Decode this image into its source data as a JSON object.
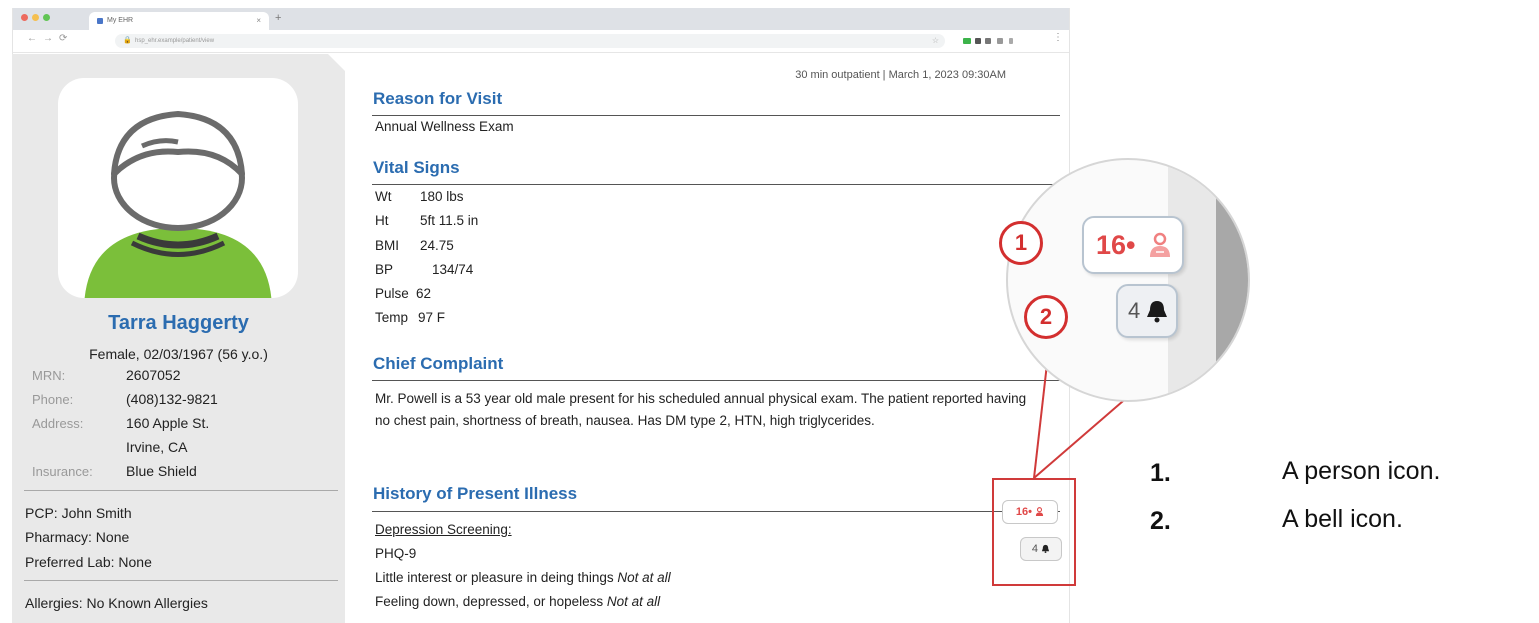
{
  "browser": {
    "tab_title": "My EHR",
    "tab_close": "×",
    "new_tab": "+",
    "nav_back": "←",
    "nav_forward": "→",
    "nav_reload": "⟳",
    "url": "hsp_ehr.example/patient/view",
    "menu": "⋮",
    "icons": [
      "back-arrow-icon",
      "forward-arrow-icon",
      "reload-icon",
      "lock-icon",
      "star-icon",
      "extension-icon",
      "menu-icon"
    ]
  },
  "patient": {
    "name": "Tarra Haggerty",
    "demographics": "Female, 02/03/1967 (56 y.o.)",
    "info": [
      {
        "label": "MRN:",
        "value": "2607052"
      },
      {
        "label": "Phone:",
        "value": "(408)132-9821"
      },
      {
        "label": "Address:",
        "value": "160 Apple St."
      },
      {
        "label": "",
        "value": "Irvine, CA"
      },
      {
        "label": "Insurance:",
        "value": "Blue Shield"
      }
    ],
    "care": [
      "PCP: John Smith",
      "Pharmacy: None",
      "Preferred Lab: None"
    ],
    "allergies": "Allergies: No Known Allergies",
    "avatar_colors": {
      "shirt": "#7bbf3a",
      "outline": "#6b6b6b"
    }
  },
  "note": {
    "visit_meta": "30 min outpatient | March 1, 2023 09:30AM",
    "reason_heading": "Reason for Visit",
    "reason": "Annual Wellness Exam",
    "vitals_heading": "Vital Signs",
    "vitals": [
      {
        "label": "Wt",
        "value": "180 lbs"
      },
      {
        "label": "Ht",
        "value": "5ft 11.5 in"
      },
      {
        "label": "BMI",
        "value": "24.75"
      },
      {
        "label": "BP",
        "value": "134/74"
      },
      {
        "label": "Pulse",
        "value": "62"
      },
      {
        "label": "Temp",
        "value": "97 F"
      }
    ],
    "complaint_heading": "Chief Complaint",
    "complaint": "Mr. Powell is a 53 year old male present for his scheduled annual physical exam. The patient reported having no chest pain, shortness of breath, nausea. Has DM type 2, HTN, high triglycerides.",
    "hpi_heading": "History of Present Illness",
    "screening_title": "Depression Screening:",
    "phq": "PHQ-9",
    "screening_items": [
      {
        "question": "Little interest or pleasure in deing things ",
        "answer": "Not at all"
      },
      {
        "question": "Feeling down, depressed, or hopeless ",
        "answer": "Not at all"
      }
    ]
  },
  "badges": {
    "person_count": "16•",
    "bell_count": "4",
    "icons": [
      "person-icon",
      "bell-icon"
    ],
    "accent_color": "#e04848"
  },
  "callout": {
    "markers": [
      "1",
      "2"
    ],
    "highlight_color": "#d32f2f"
  },
  "legend": [
    {
      "num": "1.",
      "text": "A person icon."
    },
    {
      "num": "2.",
      "text": "A bell icon."
    }
  ]
}
